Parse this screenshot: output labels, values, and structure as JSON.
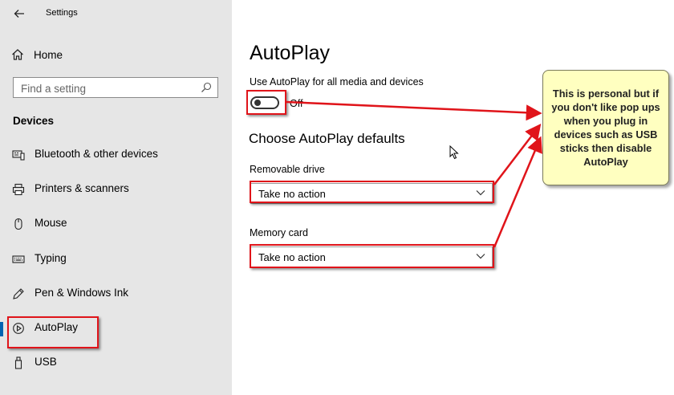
{
  "window": {
    "title": "Settings"
  },
  "sidebar": {
    "home_label": "Home",
    "search_placeholder": "Find a setting",
    "section_label": "Devices",
    "items": [
      {
        "label": "Bluetooth & other devices",
        "icon": "bluetooth-devices-icon"
      },
      {
        "label": "Printers & scanners",
        "icon": "printer-icon"
      },
      {
        "label": "Mouse",
        "icon": "mouse-icon"
      },
      {
        "label": "Typing",
        "icon": "keyboard-icon"
      },
      {
        "label": "Pen & Windows Ink",
        "icon": "pen-icon"
      },
      {
        "label": "AutoPlay",
        "icon": "autoplay-icon",
        "selected": true
      },
      {
        "label": "USB",
        "icon": "usb-icon"
      }
    ]
  },
  "main": {
    "title": "AutoPlay",
    "toggle_description": "Use AutoPlay for all media and devices",
    "toggle_state": "Off",
    "defaults_heading": "Choose AutoPlay defaults",
    "removable_drive": {
      "label": "Removable drive",
      "value": "Take no action"
    },
    "memory_card": {
      "label": "Memory card",
      "value": "Take no action"
    }
  },
  "annotation": {
    "text": "This is personal but if you don't like pop ups when you plug in devices such as USB sticks then disable AutoPlay"
  },
  "colors": {
    "sidebar_bg": "#e6e6e6",
    "accent": "#0063b1",
    "highlight_red": "#e0141a",
    "callout_bg": "#ffffc0"
  }
}
